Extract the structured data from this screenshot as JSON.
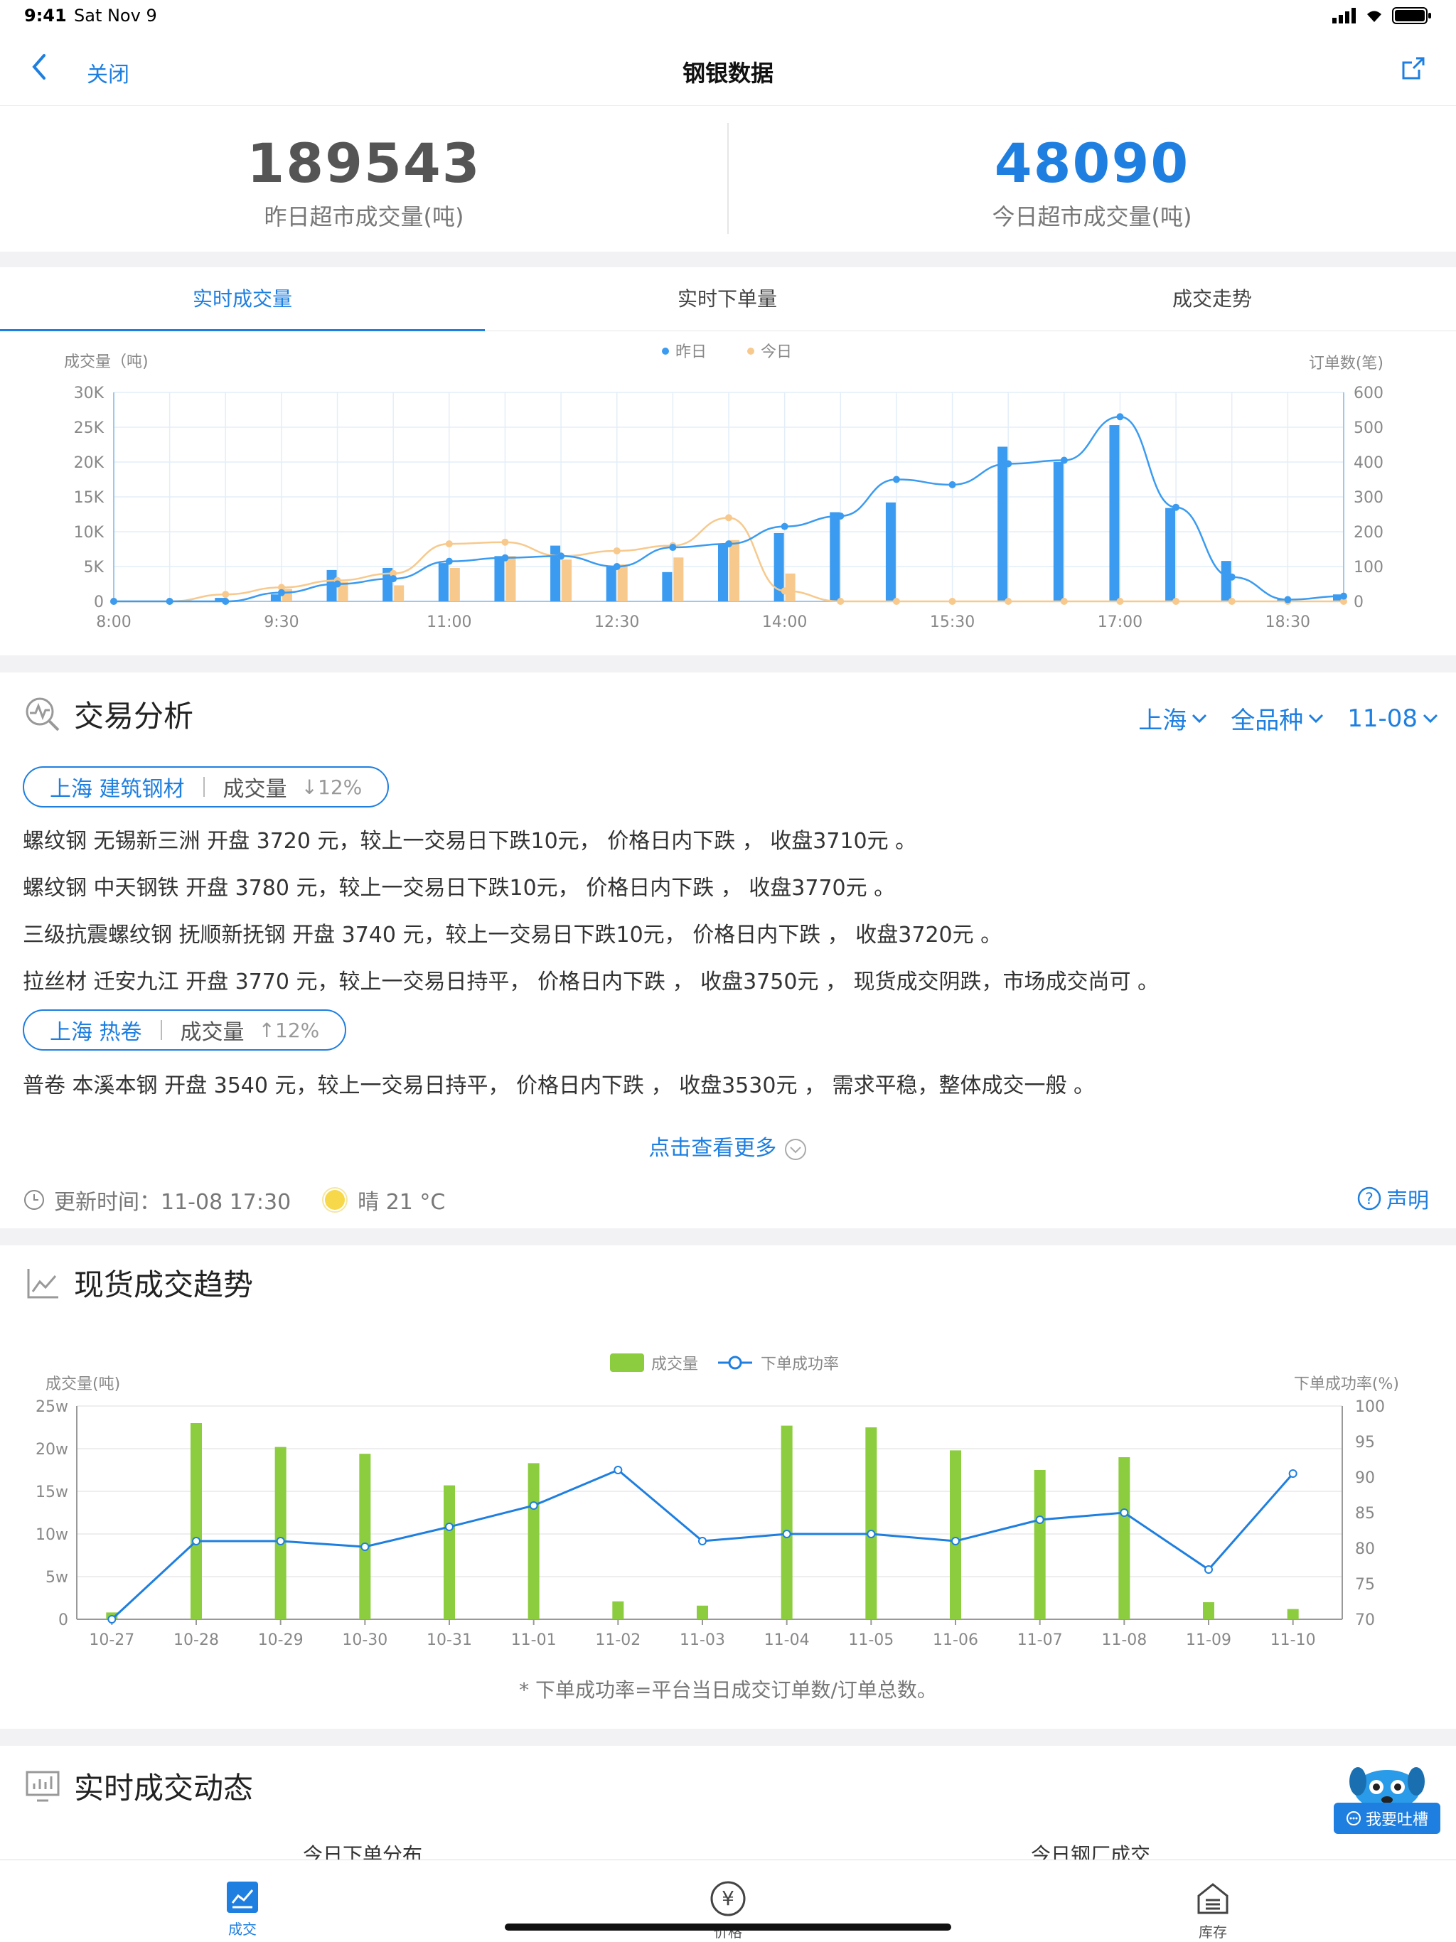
{
  "status": {
    "time": "9:41",
    "date": "Sat Nov 9"
  },
  "nav": {
    "close_label": "关闭",
    "title": "钢银数据"
  },
  "summary": {
    "yesterday_value": "189543",
    "yesterday_label": "昨日超市成交量(吨)",
    "today_value": "48090",
    "today_label": "今日超市成交量(吨)"
  },
  "tabs": [
    {
      "label": "实时成交量"
    },
    {
      "label": "实时下单量"
    },
    {
      "label": "成交走势"
    }
  ],
  "colors": {
    "accent": "#1e7fe0",
    "bar_yesterday": "#3a9bf0",
    "bar_today": "#f7c98d",
    "green": "#8ccc3f"
  },
  "chart_data": [
    {
      "type": "bar",
      "ylabel_left": "成交量（吨)",
      "ylabel_right": "订单数(笔)",
      "legend": [
        "昨日",
        "今日"
      ],
      "legend_position": "top",
      "y_left_ticks": [
        "0",
        "5K",
        "10K",
        "15K",
        "20K",
        "25K",
        "30K"
      ],
      "y_right_ticks": [
        "0",
        "100",
        "200",
        "300",
        "400",
        "500",
        "600"
      ],
      "ylim_left": [
        0,
        30000
      ],
      "ylim_right": [
        0,
        600
      ],
      "x_ticks": [
        "8:00",
        "9:30",
        "11:00",
        "12:30",
        "14:00",
        "15:30",
        "17:00",
        "18:30"
      ],
      "categories": [
        "8:00",
        "8:30",
        "9:00",
        "9:30",
        "10:00",
        "10:30",
        "11:00",
        "11:30",
        "12:00",
        "12:30",
        "13:00",
        "13:30",
        "14:00",
        "14:30",
        "15:00",
        "15:30",
        "16:00",
        "16:30",
        "17:00",
        "17:30",
        "18:00",
        "18:30",
        "19:00"
      ],
      "series": [
        {
          "name": "昨日",
          "values": [
            0,
            0,
            500,
            1000,
            4500,
            4800,
            5500,
            6500,
            8000,
            5000,
            4200,
            8300,
            9800,
            12800,
            14200,
            0,
            22200,
            20000,
            25300,
            13400,
            5800,
            300,
            1000
          ]
        },
        {
          "name": "今日",
          "values": [
            0,
            0,
            0,
            1800,
            2800,
            2300,
            4800,
            6500,
            6000,
            5300,
            6300,
            8800,
            4000,
            0,
            0,
            0,
            0,
            0,
            0,
            0,
            0,
            0,
            0
          ]
        },
        {
          "name": "昨日订单",
          "values": [
            0,
            0,
            0,
            25,
            50,
            65,
            115,
            125,
            130,
            100,
            155,
            165,
            215,
            245,
            350,
            335,
            395,
            405,
            530,
            270,
            70,
            5,
            15
          ]
        },
        {
          "name": "今日订单",
          "values": [
            0,
            0,
            20,
            40,
            60,
            80,
            165,
            170,
            130,
            145,
            160,
            240,
            30,
            0,
            0,
            0,
            0,
            0,
            0,
            0,
            0,
            0,
            0
          ]
        }
      ]
    },
    {
      "type": "bar",
      "ylabel_left": "成交量(吨)",
      "ylabel_right": "下单成功率(%)",
      "legend": [
        "成交量",
        "下单成功率"
      ],
      "legend_position": "top",
      "y_left_ticks": [
        "0",
        "5w",
        "10w",
        "15w",
        "20w",
        "25w"
      ],
      "y_right_ticks": [
        "70",
        "75",
        "80",
        "85",
        "90",
        "95",
        "100"
      ],
      "ylim_left": [
        0,
        250000
      ],
      "ylim_right": [
        70,
        100
      ],
      "categories": [
        "10-27",
        "10-28",
        "10-29",
        "10-30",
        "10-31",
        "11-01",
        "11-02",
        "11-03",
        "11-04",
        "11-05",
        "11-06",
        "11-07",
        "11-08",
        "11-09",
        "11-10"
      ],
      "series": [
        {
          "name": "成交量",
          "values": [
            8000,
            230000,
            202000,
            194000,
            157000,
            183000,
            21000,
            16000,
            227000,
            225000,
            198000,
            175000,
            190000,
            20000,
            12000
          ]
        },
        {
          "name": "下单成功率",
          "values": [
            70,
            81,
            81,
            80.2,
            83,
            86,
            91,
            81,
            82,
            82,
            81,
            84,
            85,
            77,
            90.5
          ]
        }
      ]
    }
  ],
  "analysis": {
    "title": "交易分析",
    "filters": [
      "上海",
      "全品种",
      "11-08"
    ],
    "groups": [
      {
        "name": "上海 建筑钢材",
        "metric": "成交量",
        "change": "↓12%",
        "lines": [
          "螺纹钢 无锡新三洲 开盘 3720 元，较上一交易日下跌10元， 价格日内下跌 ， 收盘3710元 。",
          "螺纹钢 中天钢铁 开盘 3780 元，较上一交易日下跌10元， 价格日内下跌 ， 收盘3770元 。",
          "三级抗震螺纹钢 抚顺新抚钢 开盘 3740 元，较上一交易日下跌10元， 价格日内下跌 ， 收盘3720元 。",
          "拉丝材 迁安九江 开盘 3770 元，较上一交易日持平， 价格日内下跌 ， 收盘3750元 ， 现货成交阴跌，市场成交尚可 。"
        ]
      },
      {
        "name": "上海 热卷",
        "metric": "成交量",
        "change": "↑12%",
        "lines": [
          "普卷 本溪本钢 开盘 3540 元，较上一交易日持平， 价格日内下跌 ， 收盘3530元 ， 需求平稳，整体成交一般 。"
        ]
      }
    ],
    "more": "点击查看更多",
    "update": "更新时间：11-08 17:30",
    "weather": "晴 21 °C",
    "statement": "声明"
  },
  "trend": {
    "title": "现货成交趋势",
    "note": "* 下单成功率=平台当日成交订单数/订单总数。"
  },
  "dynamics": {
    "title": "实时成交动态",
    "sub_left": "今日下单分布",
    "sub_right": "今日钢厂成交"
  },
  "feedback": {
    "label": "我要吐槽"
  },
  "bottom_tabs": [
    {
      "label": "成交"
    },
    {
      "label": "价格"
    },
    {
      "label": "库存"
    }
  ]
}
